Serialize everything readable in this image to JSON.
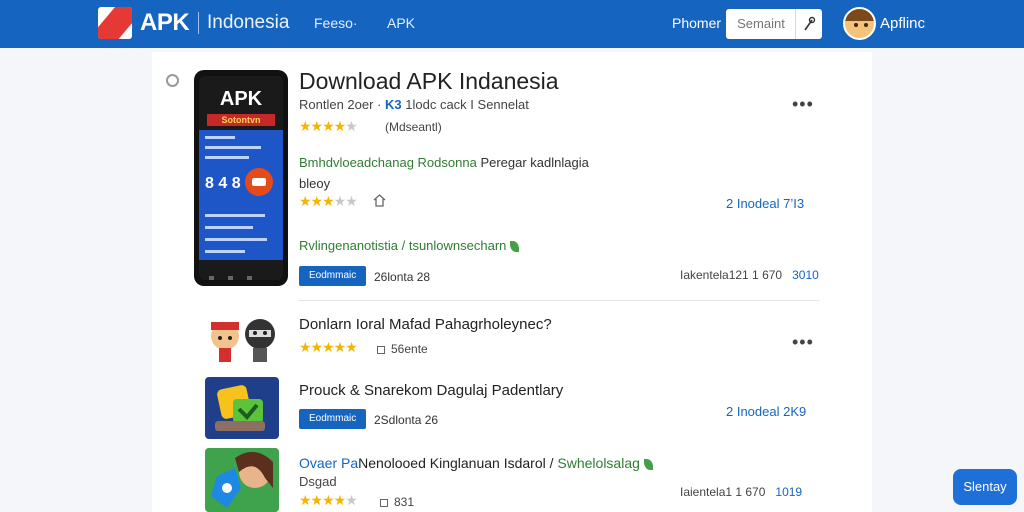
{
  "header": {
    "brand": "APK",
    "brand_sub": "Indonesia",
    "nav": [
      "Feeso·",
      "APK"
    ],
    "phone_label": "Phomer",
    "search_placeholder": "Semaint",
    "user_name": "Apflinc"
  },
  "featured": {
    "phone_screen_title": "APK",
    "phone_screen_banner": "Sotontvn",
    "phone_screen_number": "8 4 8",
    "title": "Download APK Indanesia",
    "subtitle_pre": "Rontlen 2oer ·",
    "subtitle_highlight": "K3",
    "subtitle_post": "1lodc cack I Sennelat",
    "rating": 4,
    "rating_note": "(Mdseantl)",
    "desc_green": "Bmhdvloeadchanag Rodsonna",
    "desc_rest": "Peregar kadlnlagia",
    "desc_line2": "bleoy",
    "rating2": 3,
    "stats": "2 Inodeal  7’I3",
    "green_line": "Rvlingenanotistia / tsunlownsecharn",
    "download_label": "Eodmmaic",
    "version": "26lonta 28",
    "size_meta": "Iakentela121 1 670",
    "size_value": "3010",
    "more": "•••"
  },
  "items": [
    {
      "title": "Donlarn Ioral Mafad Pahagrholeynec?",
      "rating": 5,
      "meta": "56ente",
      "more": "•••"
    },
    {
      "title": "Prouck & Snarekom Dagulaj Padentlary",
      "download_label": "Eodmmaic",
      "version": "2Sdlonta 26",
      "stats": "2 Inodeal  2K9"
    },
    {
      "title_blue": "Ovaer Pa",
      "title_mid": "Nenolooed Kinglanuan Isdarol /",
      "title_green": "Swhelolsalag",
      "line2": "Dsgad",
      "rating": 4,
      "meta": "831",
      "size_meta": "Iaientela1 1 670",
      "size_value": "1019"
    }
  ],
  "sticky_button": "Slentay"
}
